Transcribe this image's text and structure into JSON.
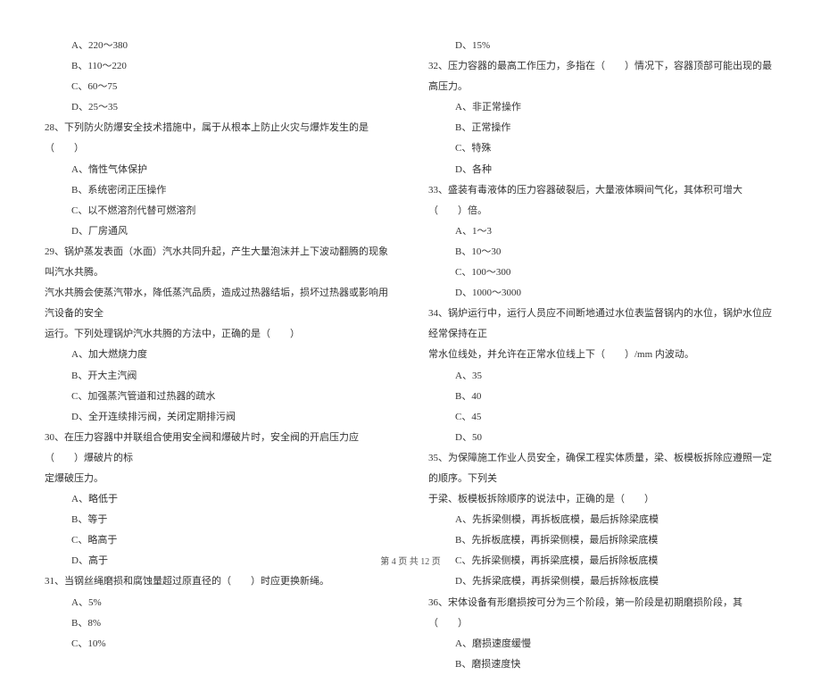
{
  "left": {
    "opts_a": [
      "A、220～380",
      "B、110～220",
      "C、60～75",
      "D、25～35"
    ],
    "q28": "28、下列防火防爆安全技术措施中，属于从根本上防止火灾与爆炸发生的是（　　）",
    "q28_opts": [
      "A、惰性气体保护",
      "B、系统密闭正压操作",
      "C、以不燃溶剂代替可燃溶剂",
      "D、厂房通风"
    ],
    "q29": "29、锅炉蒸发表面（水面）汽水共同升起，产生大量泡沫并上下波动翻腾的现象叫汽水共腾。",
    "q29_c1": "汽水共腾会使蒸汽带水，降低蒸汽品质，造成过热器结垢，损坏过热器或影响用汽设备的安全",
    "q29_c2": "运行。下列处理锅炉汽水共腾的方法中，正确的是（　　）",
    "q29_opts": [
      "A、加大燃烧力度",
      "B、开大主汽阀",
      "C、加强蒸汽管道和过热器的疏水",
      "D、全开连续排污阀，关闭定期排污阀"
    ],
    "q30": "30、在压力容器中并联组合使用安全阀和爆破片时，安全阀的开启压力应（　　）爆破片的标",
    "q30_c1": "定爆破压力。",
    "q30_opts": [
      "A、略低于",
      "B、等于",
      "C、略高于",
      "D、高于"
    ],
    "q31": "31、当钢丝绳磨损和腐蚀量超过原直径的（　　）时应更换新绳。",
    "q31_opts": [
      "A、5%",
      "B、8%",
      "C、10%"
    ]
  },
  "right": {
    "opt_d": "D、15%",
    "q32": "32、压力容器的最高工作压力，多指在（　　）情况下，容器顶部可能出现的最高压力。",
    "q32_opts": [
      "A、非正常操作",
      "B、正常操作",
      "C、特殊",
      "D、各种"
    ],
    "q33": "33、盛装有毒液体的压力容器破裂后，大量液体瞬间气化，其体积可增大（　　）倍。",
    "q33_opts": [
      "A、1～3",
      "B、10～30",
      "C、100～300",
      "D、1000～3000"
    ],
    "q34": "34、锅炉运行中，运行人员应不间断地通过水位表监督锅内的水位，锅炉水位应经常保持在正",
    "q34_c1": "常水位线处，并允许在正常水位线上下（　　）/mm 内波动。",
    "q34_opts": [
      "A、35",
      "B、40",
      "C、45",
      "D、50"
    ],
    "q35": "35、为保障施工作业人员安全，确保工程实体质量，梁、板模板拆除应遵照一定的顺序。下列关",
    "q35_c1": "于梁、板模板拆除顺序的说法中，正确的是（　　）",
    "q35_opts": [
      "A、先拆梁侧模，再拆板底模，最后拆除梁底模",
      "B、先拆板底模，再拆梁侧模，最后拆除梁底模",
      "C、先拆梁侧模，再拆梁底模，最后拆除板底模",
      "D、先拆梁底模，再拆梁侧模，最后拆除板底模"
    ],
    "q36": "36、宋体设备有形磨损按可分为三个阶段，第一阶段是初期磨损阶段，其（　　）",
    "q36_opts": [
      "A、磨损速度缓慢",
      "B、磨损速度快"
    ]
  },
  "footer": "第 4 页 共 12 页"
}
